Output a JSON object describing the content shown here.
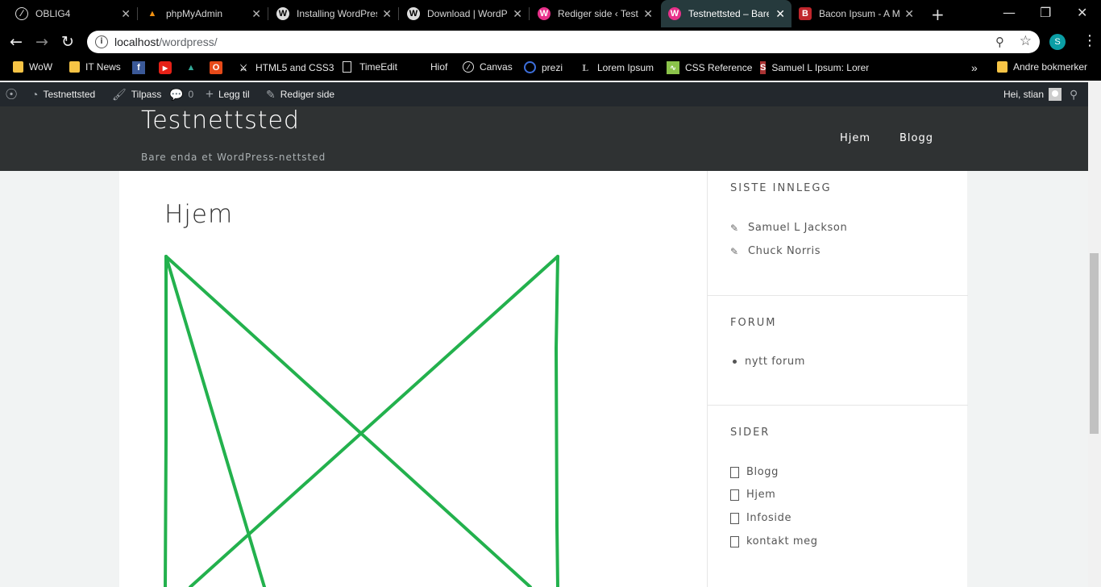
{
  "browser": {
    "tabs": [
      {
        "title": "OBLIG4",
        "icon": "notion-icon"
      },
      {
        "title": "phpMyAdmin",
        "icon": "phpmyadmin-icon"
      },
      {
        "title": "Installing WordPress",
        "icon": "wordpress-icon"
      },
      {
        "title": "Download | WordPress",
        "icon": "wordpress-icon"
      },
      {
        "title": "Rediger side ‹ Testnettsted",
        "icon": "wp-pink-icon"
      },
      {
        "title": "Testnettsted – Bare enda",
        "icon": "wp-pink-icon",
        "active": true
      },
      {
        "title": "Bacon Ipsum - A Meatier",
        "icon": "bacon-icon"
      }
    ],
    "close_glyph": "✕",
    "new_tab_glyph": "+",
    "url_host": "localhost",
    "url_path": "/wordpress/",
    "profile_initial": "S",
    "bookmarks": [
      {
        "label": "WoW"
      },
      {
        "label": "IT News"
      },
      {
        "label": ""
      },
      {
        "label": ""
      },
      {
        "label": ""
      },
      {
        "label": ""
      },
      {
        "label": "HTML5 and CSS3"
      },
      {
        "label": "TimeEdit"
      },
      {
        "label": "Hiof"
      },
      {
        "label": "Canvas"
      },
      {
        "label": "prezi"
      },
      {
        "label": "Lorem Ipsum"
      },
      {
        "label": "CSS Reference"
      },
      {
        "label": "Samuel L Ipsum: Lorem"
      }
    ],
    "more_bookmarks": "»",
    "other_bookmarks": "Andre bokmerker"
  },
  "adminbar": {
    "site_name": "Testnettsted",
    "customize": "Tilpass",
    "comments_count": "0",
    "new": "Legg til",
    "edit": "Rediger side",
    "greeting": "Hei, stian"
  },
  "site": {
    "title": "Testnettsted",
    "description": "Bare enda et WordPress-nettsted",
    "nav": [
      "Hjem",
      "Blogg"
    ]
  },
  "page": {
    "title": "Hjem",
    "drawing_color": "#23b14d"
  },
  "sidebar": {
    "recent_title": "SISTE INNLEGG",
    "recent_posts": [
      "Samuel L Jackson",
      "Chuck Norris"
    ],
    "forum_title": "FORUM",
    "forum_items": [
      "nytt forum"
    ],
    "pages_title": "SIDER",
    "pages": [
      "Blogg",
      "Hjem",
      "Infoside",
      "kontakt meg"
    ]
  }
}
